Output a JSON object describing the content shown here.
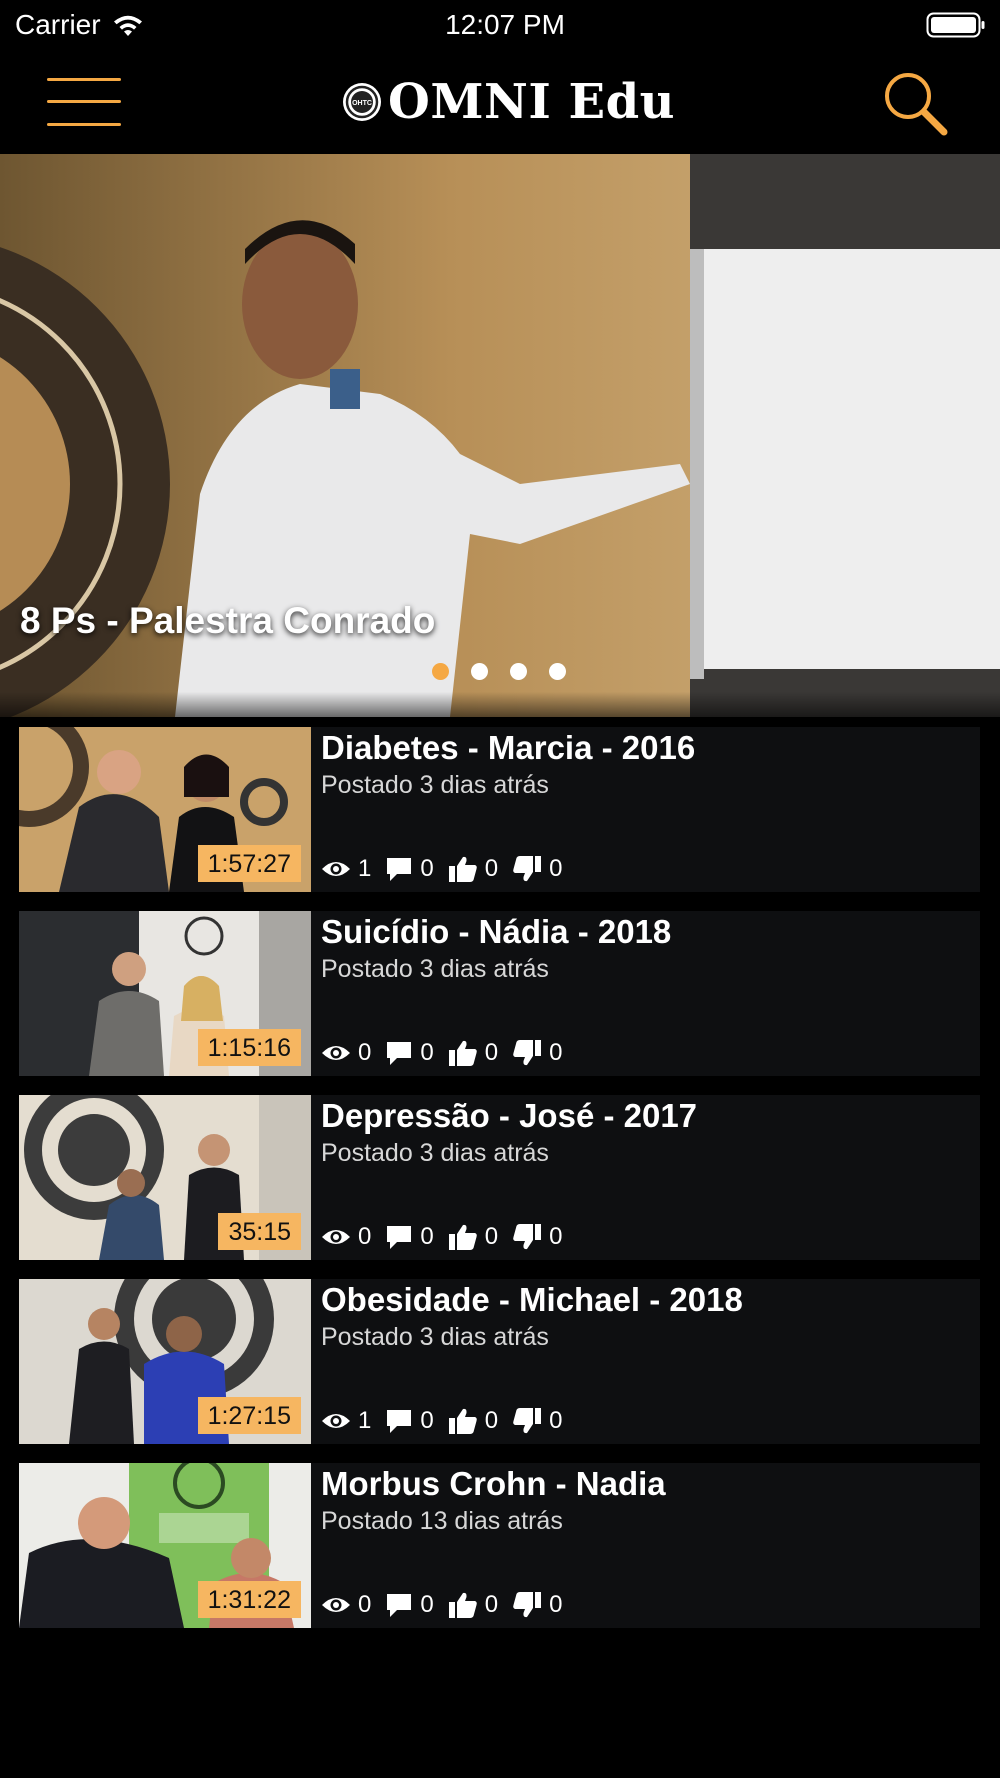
{
  "status_bar": {
    "carrier": "Carrier",
    "time": "12:07 PM"
  },
  "header": {
    "brand": "OMNI Edu",
    "logo_text": "OHTC",
    "accent_color": "#f5a843",
    "menu_icon": "hamburger-menu-icon",
    "search_icon": "search-icon"
  },
  "hero": {
    "title": "8 Ps - Palestra Conrado",
    "slide_count": 4,
    "active_slide": 1
  },
  "videos": [
    {
      "title": "Diabetes - Marcia - 2016",
      "posted": "Postado 3 dias atrás",
      "duration": "1:57:27",
      "views": "1",
      "comments": "0",
      "likes": "0",
      "dislikes": "0"
    },
    {
      "title": "Suicídio - Nádia - 2018",
      "posted": "Postado 3 dias atrás",
      "duration": "1:15:16",
      "views": "0",
      "comments": "0",
      "likes": "0",
      "dislikes": "0"
    },
    {
      "title": "Depressão - José - 2017",
      "posted": "Postado 3 dias atrás",
      "duration": "35:15",
      "views": "0",
      "comments": "0",
      "likes": "0",
      "dislikes": "0"
    },
    {
      "title": "Obesidade - Michael - 2018",
      "posted": "Postado 3 dias atrás",
      "duration": "1:27:15",
      "views": "1",
      "comments": "0",
      "likes": "0",
      "dislikes": "0"
    },
    {
      "title": "Morbus Crohn - Nadia",
      "posted": "Postado 13 dias atrás",
      "duration": "1:31:22",
      "views": "0",
      "comments": "0",
      "likes": "0",
      "dislikes": "0"
    }
  ]
}
